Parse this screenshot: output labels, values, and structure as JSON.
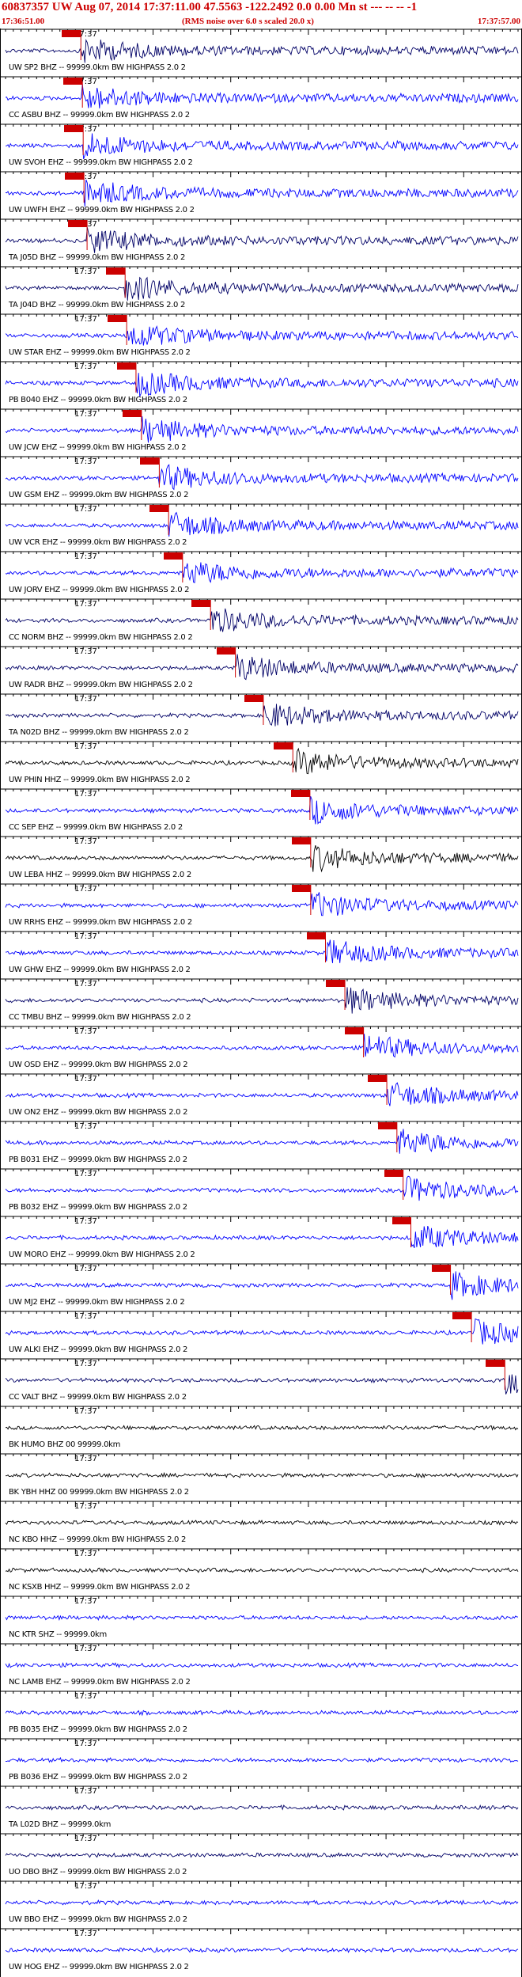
{
  "header": {
    "title": "60837357 UW Aug 07, 2014 17:37:11.00   47.5563 -122.2492  0.0 0.00 Mn st --- -- -- -1",
    "start_time": "17:36:51.00",
    "rms_note": "(RMS noise over 6.0 s scaled 20.0 x)",
    "end_time": "17:37:57.00"
  },
  "colors": {
    "header_text": "#cc0000",
    "pick": "#cc0000",
    "blue": "#0000ff",
    "navy": "#000066",
    "black": "#000000"
  },
  "chart_data": {
    "type": "line",
    "x_range_seconds": [
      0,
      66
    ],
    "minute_tick_label": "17:37",
    "traces": [
      {
        "label": "UW SP2 BHZ -- 99999.0km BW  HIGHPASS  2.0  2",
        "pick_s": 9.7,
        "color": "#000066"
      },
      {
        "label": "CC ASBU BHZ -- 99999.0km BW  HIGHPASS  2.0  2",
        "pick_s": 9.9,
        "color": "#0000ff"
      },
      {
        "label": "UW SVOH EHZ -- 99999.0km BW  HIGHPASS  2.0  2",
        "pick_s": 10.0,
        "color": "#0000ff"
      },
      {
        "label": "UW UWFH EHZ -- 99999.0km BW  HIGHPASS  2.0  2",
        "pick_s": 10.1,
        "color": "#0000ff"
      },
      {
        "label": "TA J05D BHZ -- 99999.0km BW  HIGHPASS  2.0  2",
        "pick_s": 10.5,
        "color": "#000066"
      },
      {
        "label": "TA J04D BHZ -- 99999.0km BW  HIGHPASS  2.0  2",
        "pick_s": 15.4,
        "color": "#000066"
      },
      {
        "label": "UW STAR EHZ -- 99999.0km BW  HIGHPASS  2.0  2",
        "pick_s": 15.6,
        "color": "#0000ff"
      },
      {
        "label": "PB B040 EHZ -- 99999.0km BW  HIGHPASS  2.0  2",
        "pick_s": 16.8,
        "color": "#0000ff"
      },
      {
        "label": "UW JCW EHZ -- 99999.0km BW  HIGHPASS  2.0  2",
        "pick_s": 17.5,
        "color": "#0000ff"
      },
      {
        "label": "UW GSM EHZ -- 99999.0km BW  HIGHPASS  2.0  2",
        "pick_s": 19.8,
        "color": "#0000ff"
      },
      {
        "label": "UW VCR EHZ -- 99999.0km BW  HIGHPASS  2.0  2",
        "pick_s": 21.0,
        "color": "#0000ff"
      },
      {
        "label": "UW JORV EHZ -- 99999.0km BW  HIGHPASS  2.0  2",
        "pick_s": 22.8,
        "color": "#0000ff"
      },
      {
        "label": "CC NORM BHZ -- 99999.0km BW  HIGHPASS  2.0  2",
        "pick_s": 26.4,
        "color": "#000066"
      },
      {
        "label": "UW RADR BHZ -- 99999.0km BW  HIGHPASS  2.0  2",
        "pick_s": 29.6,
        "color": "#000066"
      },
      {
        "label": "TA N02D BHZ -- 99999.0km BW  HIGHPASS  2.0  2",
        "pick_s": 33.2,
        "color": "#000066"
      },
      {
        "label": "UW PHIN HHZ -- 99999.0km BW  HIGHPASS  2.0  2",
        "pick_s": 37.0,
        "color": "#000000"
      },
      {
        "label": "CC SEP EHZ -- 99999.0km BW  HIGHPASS  2.0  2",
        "pick_s": 39.2,
        "color": "#0000ff"
      },
      {
        "label": "UW LEBA HHZ -- 99999.0km BW  HIGHPASS  2.0  2",
        "pick_s": 39.3,
        "color": "#000000"
      },
      {
        "label": "UW RRHS EHZ -- 99999.0km BW  HIGHPASS  2.0  2",
        "pick_s": 39.3,
        "color": "#0000ff"
      },
      {
        "label": "UW GHW EHZ -- 99999.0km BW  HIGHPASS  2.0  2",
        "pick_s": 41.2,
        "color": "#0000ff"
      },
      {
        "label": "CC TMBU BHZ -- 99999.0km BW  HIGHPASS  2.0  2",
        "pick_s": 43.7,
        "color": "#000066"
      },
      {
        "label": "UW OSD EHZ -- 99999.0km BW  HIGHPASS  2.0  2",
        "pick_s": 46.1,
        "color": "#0000ff"
      },
      {
        "label": "UW ON2 EHZ -- 99999.0km BW  HIGHPASS  2.0  2",
        "pick_s": 49.1,
        "color": "#0000ff"
      },
      {
        "label": "PB B031 EHZ -- 99999.0km BW  HIGHPASS  2.0  2",
        "pick_s": 50.4,
        "color": "#0000ff"
      },
      {
        "label": "PB B032 EHZ -- 99999.0km BW  HIGHPASS  2.0  2",
        "pick_s": 51.2,
        "color": "#0000ff"
      },
      {
        "label": "UW MORO EHZ -- 99999.0km BW  HIGHPASS  2.0  2",
        "pick_s": 52.2,
        "color": "#0000ff"
      },
      {
        "label": "UW MJ2 EHZ -- 99999.0km BW  HIGHPASS  2.0  2",
        "pick_s": 57.3,
        "color": "#0000ff"
      },
      {
        "label": "UW ALKI EHZ -- 99999.0km BW  HIGHPASS  2.0  2",
        "pick_s": 60.0,
        "color": "#0000ff"
      },
      {
        "label": "CC VALT BHZ -- 99999.0km BW  HIGHPASS  2.0  2",
        "pick_s": 64.3,
        "color": "#000066"
      },
      {
        "label": "BK HUMO BHZ 00 99999.0km",
        "pick_s": null,
        "color": "#000000"
      },
      {
        "label": "BK YBH HHZ 00 99999.0km BW  HIGHPASS  2.0  2",
        "pick_s": null,
        "color": "#000000"
      },
      {
        "label": "NC KBO HHZ -- 99999.0km BW  HIGHPASS  2.0  2",
        "pick_s": null,
        "color": "#000000"
      },
      {
        "label": "NC KSXB HHZ -- 99999.0km BW  HIGHPASS  2.0  2",
        "pick_s": null,
        "color": "#000000"
      },
      {
        "label": "NC KTR SHZ -- 99999.0km",
        "pick_s": null,
        "color": "#0000ff"
      },
      {
        "label": "NC LAMB EHZ -- 99999.0km BW  HIGHPASS  2.0  2",
        "pick_s": null,
        "color": "#0000ff"
      },
      {
        "label": "PB B035 EHZ -- 99999.0km BW  HIGHPASS  2.0  2",
        "pick_s": null,
        "color": "#0000ff"
      },
      {
        "label": "PB B036 EHZ -- 99999.0km BW  HIGHPASS  2.0  2",
        "pick_s": null,
        "color": "#0000ff"
      },
      {
        "label": "TA L02D BHZ -- 99999.0km",
        "pick_s": null,
        "color": "#000066"
      },
      {
        "label": "UO DBO BHZ -- 99999.0km BW  HIGHPASS  2.0  2",
        "pick_s": null,
        "color": "#000066"
      },
      {
        "label": "UW BBO EHZ -- 99999.0km BW  HIGHPASS  2.0  2",
        "pick_s": null,
        "color": "#0000ff"
      },
      {
        "label": "UW HOG EHZ -- 99999.0km BW  HIGHPASS  2.0  2",
        "pick_s": null,
        "color": "#0000ff"
      }
    ]
  }
}
